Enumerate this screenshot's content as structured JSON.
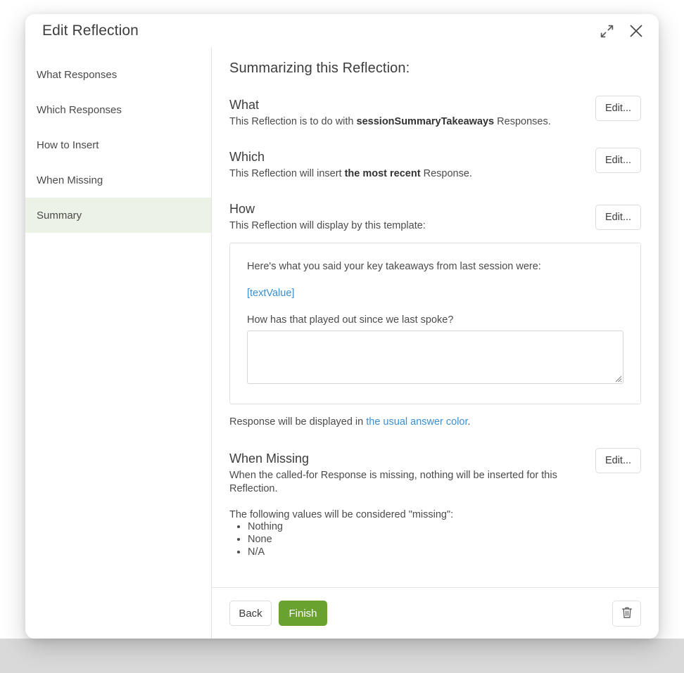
{
  "window": {
    "title": "Edit Reflection",
    "expand_icon": "expand-diagonal-icon",
    "close_icon": "close-icon"
  },
  "sidebar": {
    "items": [
      {
        "label": "What Responses",
        "active": false
      },
      {
        "label": "Which Responses",
        "active": false
      },
      {
        "label": "How to Insert",
        "active": false
      },
      {
        "label": "When Missing",
        "active": false
      },
      {
        "label": "Summary",
        "active": true
      }
    ]
  },
  "main": {
    "title": "Summarizing this Reflection:",
    "sections": {
      "what": {
        "heading": "What",
        "desc_pre": "This Reflection is to do with ",
        "desc_strong": "sessionSummaryTakeaways",
        "desc_post": " Responses.",
        "edit_label": "Edit..."
      },
      "which": {
        "heading": "Which",
        "desc_pre": "This Reflection will insert ",
        "desc_strong": "the most recent",
        "desc_post": " Response.",
        "edit_label": "Edit..."
      },
      "how": {
        "heading": "How",
        "desc": "This Reflection will display by this template:",
        "edit_label": "Edit...",
        "template": {
          "intro_line": "Here's what you said your key takeaways from last session were:",
          "token": "[textValue]",
          "prompt_line": "How has that played out since we last spoke?",
          "answer_value": "",
          "answer_placeholder": ""
        },
        "note_pre": "Response will be displayed in ",
        "note_link": "the usual answer color",
        "note_post": "."
      },
      "when_missing": {
        "heading": "When Missing",
        "desc": "When the called-for Response is missing, nothing will be inserted for this Reflection.",
        "edit_label": "Edit...",
        "list_intro": "The following values will be considered \"missing\":",
        "values": [
          "Nothing",
          "None",
          "N/A"
        ]
      }
    }
  },
  "footer": {
    "back_label": "Back",
    "finish_label": "Finish",
    "delete_icon": "trash-icon"
  },
  "colors": {
    "accent_green": "#6aa22f",
    "active_sidebar_bg": "#edf2e7",
    "link_blue": "#3b8ed0",
    "text_primary": "#3d3d3d",
    "text_secondary": "#4b4b4b",
    "border": "#e0e0e0"
  }
}
